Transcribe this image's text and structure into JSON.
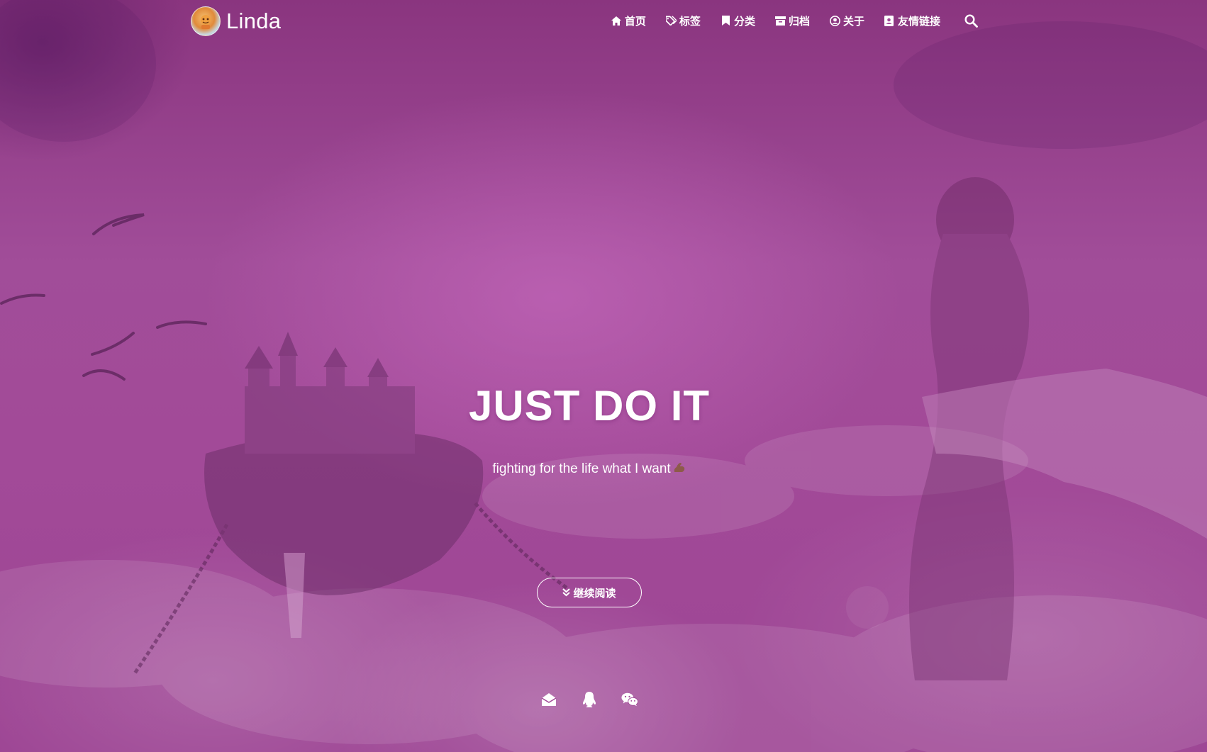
{
  "brand": {
    "name": "Linda",
    "avatar_icon": "avatar-icon"
  },
  "nav": {
    "items": [
      {
        "label": "首页",
        "icon": "home-icon"
      },
      {
        "label": "标签",
        "icon": "tags-icon"
      },
      {
        "label": "分类",
        "icon": "bookmark-icon"
      },
      {
        "label": "归档",
        "icon": "archive-icon"
      },
      {
        "label": "关于",
        "icon": "user-circle-icon"
      },
      {
        "label": "友情链接",
        "icon": "address-book-icon"
      }
    ],
    "search_icon": "search-icon"
  },
  "hero": {
    "title": "JUST DO IT",
    "subtitle": "fighting for the life what I want",
    "subtitle_emoji": "muscle-icon",
    "read_more_label": "继续阅读",
    "read_more_icon": "angle-double-down-icon"
  },
  "social": [
    {
      "icon": "envelope-open-icon"
    },
    {
      "icon": "qq-icon"
    },
    {
      "icon": "wechat-icon"
    }
  ],
  "colors": {
    "overlay": "#a24a98",
    "text": "#ffffff"
  }
}
